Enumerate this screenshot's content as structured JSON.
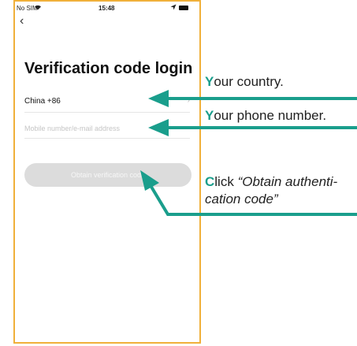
{
  "status_bar": {
    "carrier": "No SIM",
    "wifi_icon": "wifi-icon",
    "time": "15:48",
    "location_icon": "location-icon",
    "battery_icon": "battery-icon"
  },
  "nav": {
    "back_icon": "back-chevron-icon"
  },
  "page": {
    "title": "Verification code login",
    "country_value": "China +86",
    "mobile_placeholder": "Mobile number/e-mail address",
    "obtain_button_label": "Obtain verification code"
  },
  "annotations": {
    "country": {
      "initial": "Y",
      "rest": "our country."
    },
    "phone": {
      "initial": "Y",
      "rest": "our phone number."
    },
    "obtain": {
      "initial": "C",
      "line1_rest": "lick ",
      "line1_quote": "“Obtain authenti-",
      "line2_quote": "cation code”"
    }
  },
  "colors": {
    "accent_teal": "#1a9e8c",
    "frame_orange": "#f0b03a",
    "button_gray": "#dcdcdc"
  }
}
